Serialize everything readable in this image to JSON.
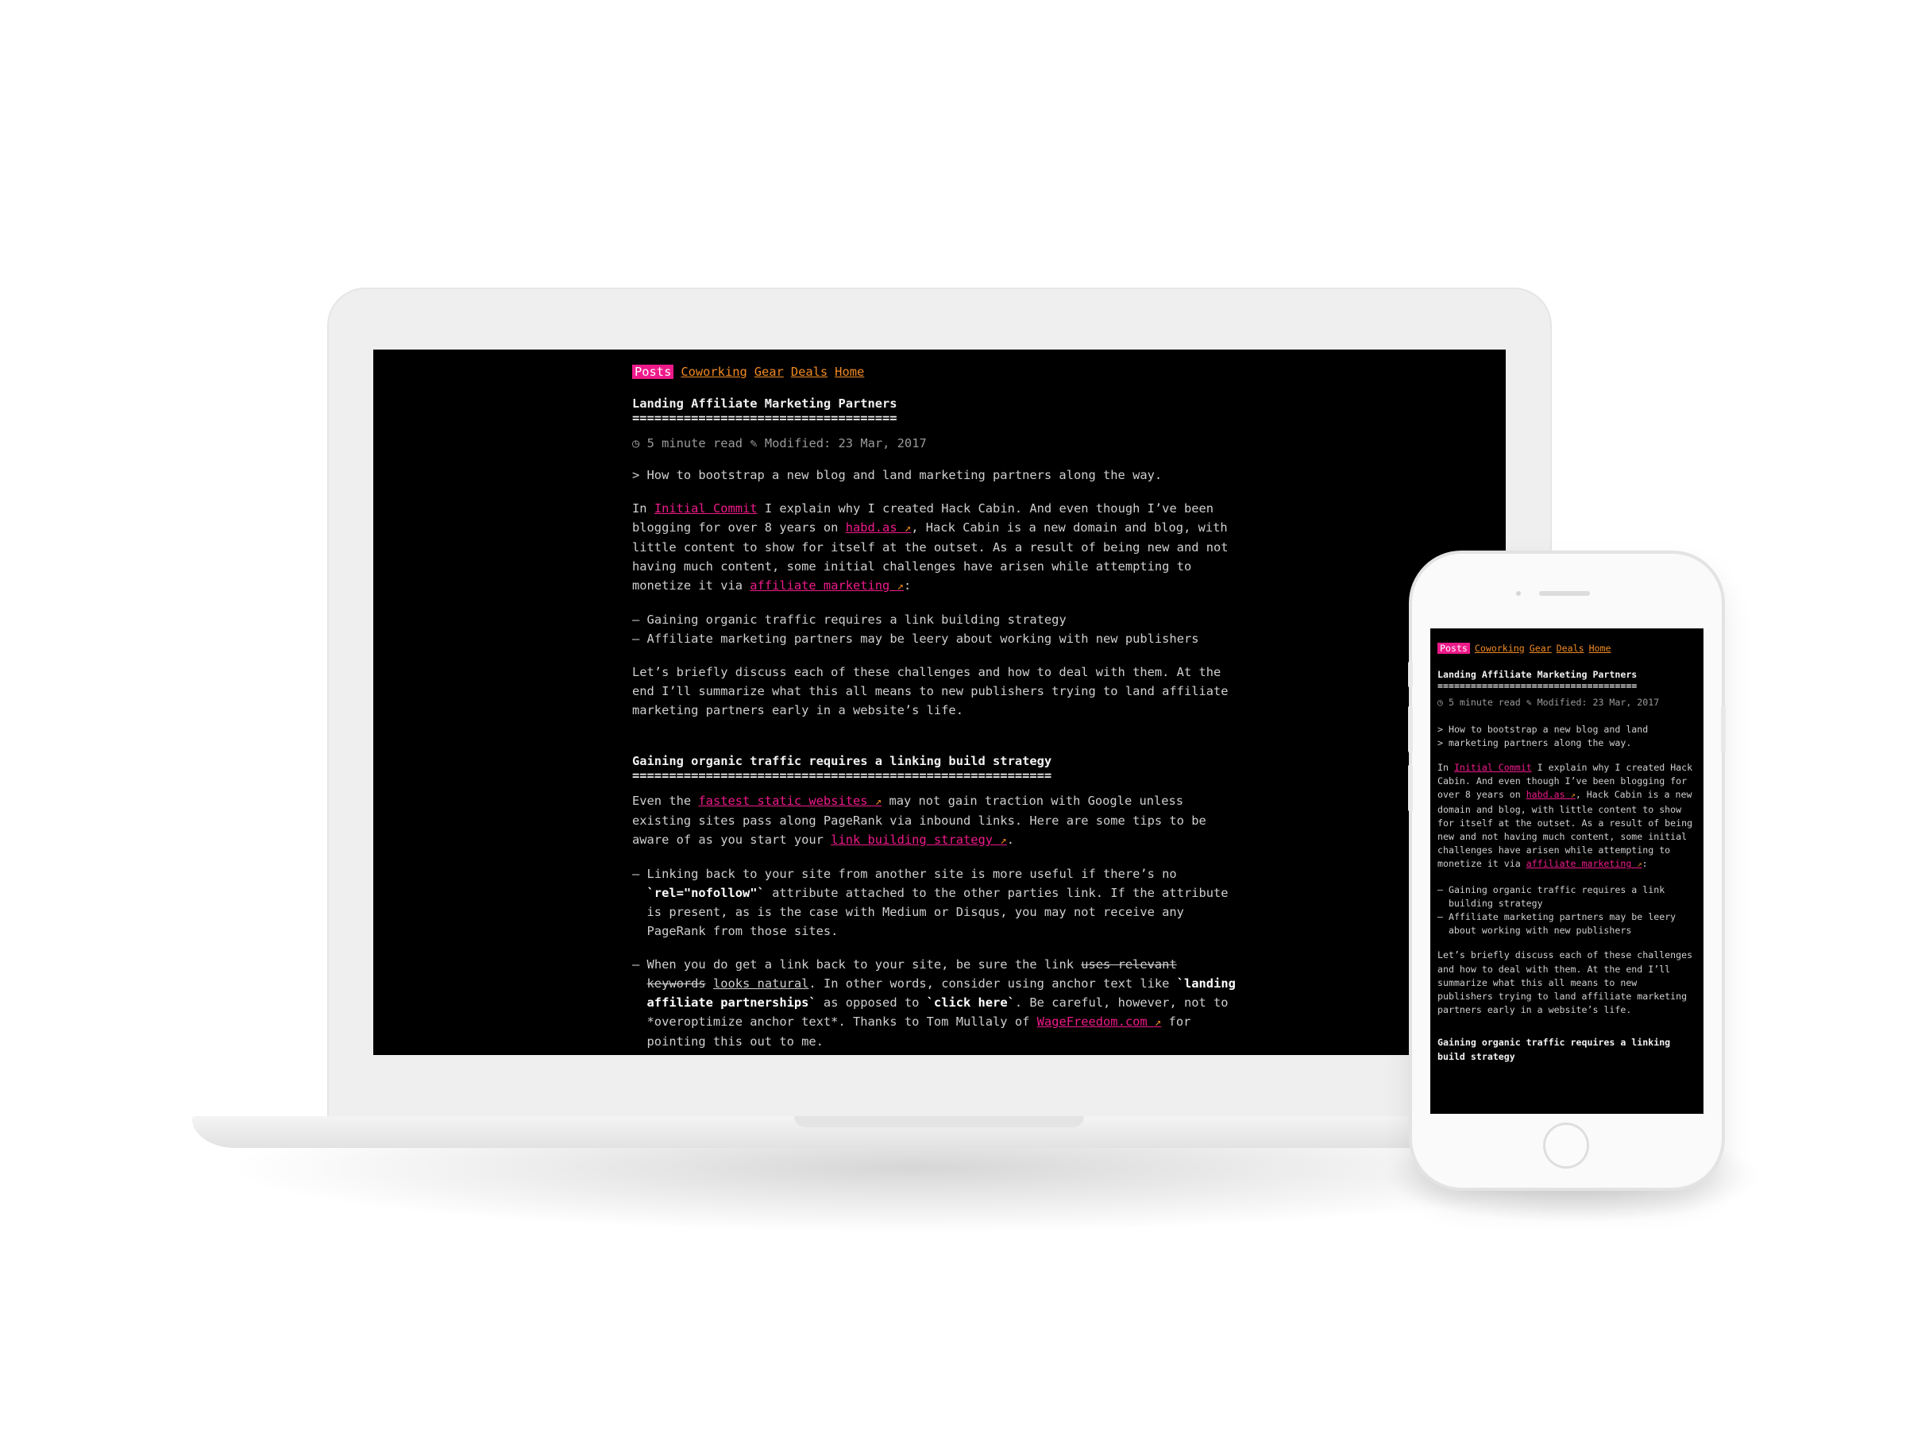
{
  "nav": {
    "posts": "Posts",
    "coworking": "Coworking",
    "gear": "Gear",
    "deals": "Deals",
    "home": "Home"
  },
  "article": {
    "title": "Landing Affiliate Marketing Partners",
    "title_rule": "====================================",
    "read_time": "5 minute read",
    "modified": "Modified: 23 Mar, 2017",
    "quote": "> How to bootstrap a new blog and land marketing partners along the way.",
    "quote_line1": "> How to bootstrap a new blog and land",
    "quote_line2": "> marketing partners along the way.",
    "p1_a": "In ",
    "p1_link1": "Initial Commit",
    "p1_b": " I explain why I created Hack Cabin. And even though I’ve been blogging for over 8 years on ",
    "p1_link2": "habd.as",
    "p1_c": ", Hack Cabin is a new domain and blog, with little content to show for itself at the outset. As a result of being new and not having much content, some initial challenges have arisen while attempting to monetize it via ",
    "p1_link3": "affiliate marketing",
    "p1_d": ":",
    "bullets": [
      "Gaining organic traffic requires a link building strategy",
      "Affiliate marketing partners may be leery about working with new publishers"
    ],
    "p2": "Let’s briefly discuss each of these challenges and how to deal with them. At the end I’ll summarize what this all means to new publishers trying to land affiliate marketing partners early in a website’s life.",
    "h2": "Gaining organic traffic requires a linking build strategy",
    "h2_rule": "=========================================================",
    "p3_a": "Even the ",
    "p3_link1": "fastest static websites",
    "p3_b": " may not gain traction with Google unless existing sites pass along PageRank via inbound links. Here are some tips to be aware of as you start your ",
    "p3_link2": "link building strategy",
    "p3_c": ".",
    "tip1_a": "Linking back to your site from another site is more useful if there’s no ",
    "tip1_code": "`rel=\"nofollow\"`",
    "tip1_b": " attribute attached to the other parties link. If the attribute is present, as is the case with Medium or Disqus, you may not receive any PageRank from those sites.",
    "tip2_a": "When you do get a link back to your site, be sure the link ",
    "tip2_strike": "uses relevant keywords",
    "tip2_space": " ",
    "tip2_under": "looks natural",
    "tip2_b": ". In other words, consider using anchor text like ",
    "tip2_code1": "`landing affiliate partnerships`",
    "tip2_c": " as opposed to ",
    "tip2_code2": "`click here`",
    "tip2_d": ". Be careful, however, not to *overoptimize anchor text*. Thanks to Tom Mullaly of ",
    "tip2_link": "WageFreedom.com",
    "tip2_e": " for pointing this out to me.",
    "ext_icon": "↗",
    "clock_icon": "◷",
    "pencil_icon": "✎",
    "dash": "– "
  },
  "colors": {
    "background": "#000000",
    "accent_pink": "#ee1a8a",
    "accent_orange": "#f08a24",
    "text": "#cfcfcf"
  }
}
